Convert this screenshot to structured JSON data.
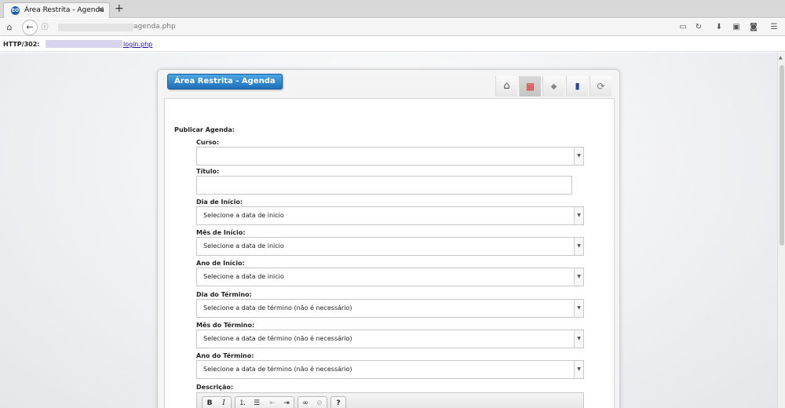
{
  "browser": {
    "tab_title": "Área Restrita - Agenda",
    "tab_close": "✕",
    "new_tab": "+",
    "url_suffix": "agenda.php",
    "status_label": "HTTP/302:",
    "status_link": "login.php"
  },
  "panel": {
    "title": "Área Restrita - Agenda",
    "toolbar_icons": [
      "home-icon",
      "calendar-icon",
      "tag-icon",
      "book-icon",
      "logout-icon"
    ],
    "active_icon": "calendar-icon"
  },
  "form": {
    "section_title": "Publicar Agenda:",
    "curso": {
      "label": "Curso:",
      "value": ""
    },
    "titulo": {
      "label": "Título:",
      "value": ""
    },
    "dia_inicio": {
      "label": "Dia de Início:",
      "value": "Selecione a data de inicio"
    },
    "mes_inicio": {
      "label": "Mês de Início:",
      "value": "Selecione a data de inicio"
    },
    "ano_inicio": {
      "label": "Ano de Início:",
      "value": "Selecione a data de inicio"
    },
    "dia_termino": {
      "label": "Dia do Término:",
      "value": "Selecione a data de término (não é necessário)"
    },
    "mes_termino": {
      "label": "Mês do Término:",
      "value": "Selecione a data de término (não é necessário)"
    },
    "ano_termino": {
      "label": "Ano do Término:",
      "value": "Selecione a data de término (não é necessário)"
    },
    "descricao": {
      "label": "Descrição:"
    }
  },
  "editor": {
    "bold": "B",
    "italic": "I",
    "help": "?",
    "buttons": [
      "bold-icon",
      "italic-icon",
      "ordered-list-icon",
      "unordered-list-icon",
      "outdent-icon",
      "indent-icon",
      "link-icon",
      "unlink-icon",
      "help-icon"
    ]
  }
}
